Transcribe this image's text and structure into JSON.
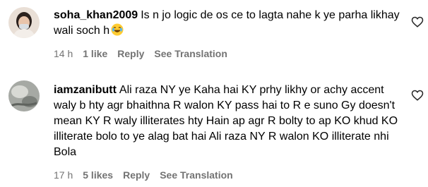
{
  "comments": [
    {
      "username": "soha_khan2009",
      "text": "Is n jo logic de os ce to lagta nahe k ye parha likhay wali soch h",
      "emoji": "😂",
      "time": "14 h",
      "likes": "1 like",
      "reply_label": "Reply",
      "translate_label": "See Translation"
    },
    {
      "username": "iamzanibutt",
      "text": "Ali raza NY ye Kaha hai KY prhy likhy or achy accent waly b hty agr bhaithna R walon KY pass hai to R e suno Gy doesn't mean KY R waly illiterates hty Hain ap agr R bolty to ap KO khud KO illiterate bolo to ye alag bat hai Ali raza NY R walon KO illiterate nhi Bola",
      "time": "17 h",
      "likes": "5 likes",
      "reply_label": "Reply",
      "translate_label": "See Translation"
    }
  ],
  "icons": {
    "like": "heart-outline-icon"
  }
}
